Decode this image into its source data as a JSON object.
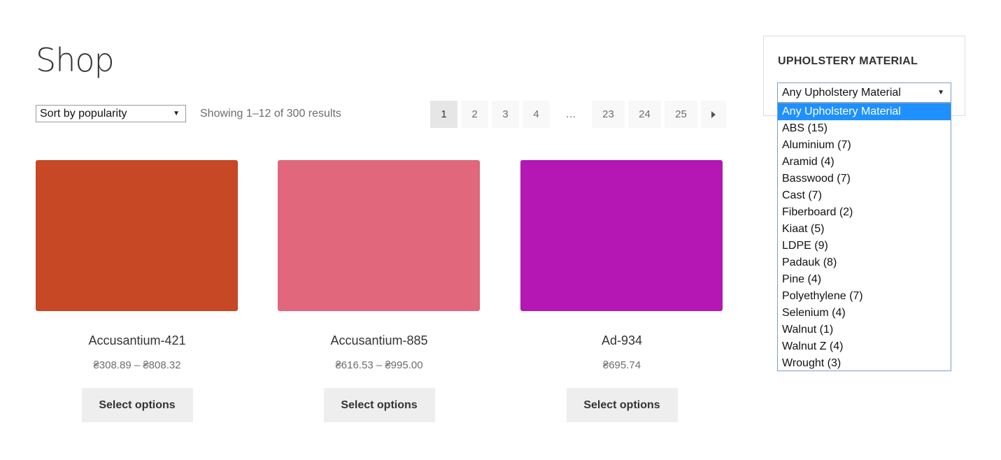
{
  "page": {
    "title": "Shop"
  },
  "toolbar": {
    "sort_value": "Sort by popularity",
    "result_count": "Showing 1–12 of 300 results"
  },
  "pagination": {
    "pages": [
      {
        "label": "1",
        "current": true
      },
      {
        "label": "2",
        "current": false
      },
      {
        "label": "3",
        "current": false
      },
      {
        "label": "4",
        "current": false
      },
      {
        "label": "…",
        "dots": true
      },
      {
        "label": "23",
        "current": false
      },
      {
        "label": "24",
        "current": false
      },
      {
        "label": "25",
        "current": false
      }
    ],
    "next_icon": "arrow-right-icon"
  },
  "products": [
    {
      "name": "Accusantium-421",
      "price": "₴308.89 – ₴808.32",
      "button": "Select options",
      "color": "#c64825"
    },
    {
      "name": "Accusantium-885",
      "price": "₴616.53 – ₴995.00",
      "button": "Select options",
      "color": "#e0677c"
    },
    {
      "name": "Ad-934",
      "price": "₴695.74",
      "button": "Select options",
      "color": "#b517b5"
    }
  ],
  "filter": {
    "title": "UPHOLSTERY MATERIAL",
    "selected": "Any Upholstery Material",
    "options": [
      "Any Upholstery Material",
      "ABS (15)",
      "Aluminium (7)",
      "Aramid (4)",
      "Basswood (7)",
      "Cast (7)",
      "Fiberboard (2)",
      "Kiaat (5)",
      "LDPE (9)",
      "Padauk (8)",
      "Pine (4)",
      "Polyethylene (7)",
      "Selenium (4)",
      "Walnut (1)",
      "Walnut Z (4)",
      "Wrought (3)"
    ],
    "highlight_color": "#1e90ff"
  }
}
